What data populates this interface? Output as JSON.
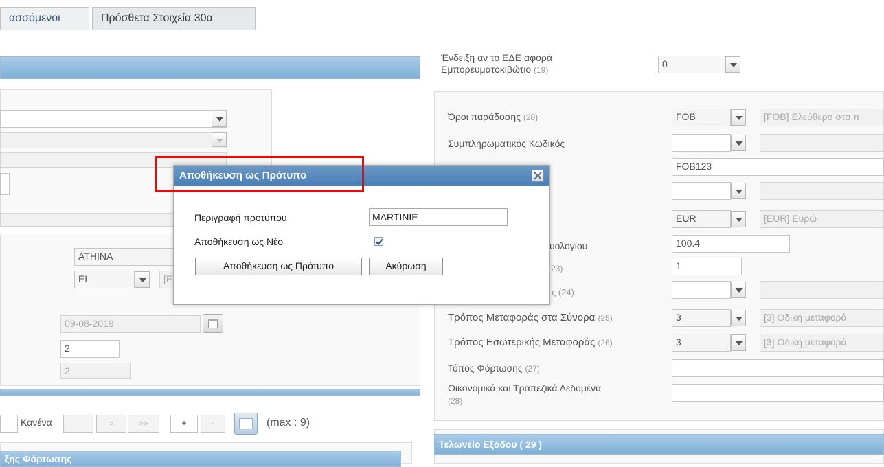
{
  "tabs": [
    {
      "label": "ασσόμενοι"
    },
    {
      "label": "Πρόσθετα Στοιχεία 30α"
    }
  ],
  "left": {
    "city_value": "ATHINA",
    "country_value": "EL",
    "country_desc": "[E",
    "date_value": "09-08-2019",
    "field_a_value": "2",
    "field_b_value": "2",
    "pager": {
      "none_label": "Κανένα",
      "next": "»",
      "last": "»»",
      "add": "+",
      "remove": "-",
      "max_label": "(max : 9)"
    },
    "bottom_section_title": "ξης Φόρτωσης"
  },
  "right": {
    "container_label": "Ένδειξη αν το ΕΔΕ αφορά Εμπορευματοκιβώτιο",
    "container_num": "(19)",
    "container_value": "0",
    "rows": {
      "delivery_terms": {
        "label": "Όροι παράδοσης",
        "num": "(20)",
        "code": "FOB",
        "desc": "[FOB] Ελεύθερο στο π"
      },
      "supplementary_code": {
        "label": "Συμπληρωματικός Κωδικός",
        "num": "",
        "code": "",
        "desc": ""
      },
      "place_value": "FOB123",
      "currency": {
        "code": "EUR",
        "desc": "[EUR] Ευρώ"
      },
      "invoice_amount": {
        "label_fragment": "υολογίου",
        "value": "100.4"
      },
      "exchange_rate": {
        "num_fragment": "23)",
        "value": "1"
      },
      "nature": {
        "num_fragment": "ς (24)"
      },
      "transport_border": {
        "label": "Τρόπος Μεταφοράς στα Σύνορα",
        "num": "(25)",
        "code": "3",
        "desc": "[3] Οδική μεταφορά"
      },
      "transport_inland": {
        "label": "Τρόπος Εσωτερικής Μεταφοράς",
        "num": "(26)",
        "code": "3",
        "desc": "[3] Οδική μεταφορά"
      },
      "loading_place": {
        "label": "Τόπος Φόρτωσης",
        "num": "(27)"
      },
      "financial": {
        "label": "Οικονομικά και Τραπεζικά Δεδομένα",
        "num": "(28)"
      }
    },
    "exit_office_title": "Τελωνείο Εξόδου ( 29 )"
  },
  "dialog": {
    "title": "Αποθήκευση ως Πρότυπο",
    "description_label": "Περιγραφή προτύπου",
    "description_value": "MARTINIE",
    "save_new_label": "Αποθήκευση ως Νέο",
    "save_new_checked": true,
    "save_button": "Αποθήκευση ως Πρότυπο",
    "cancel_button": "Ακύρωση",
    "close_icon": "close-icon"
  },
  "colors": {
    "accent": "#7fb0d8",
    "dialog_title": "#4a7fb5",
    "highlight": "#ff0000"
  }
}
